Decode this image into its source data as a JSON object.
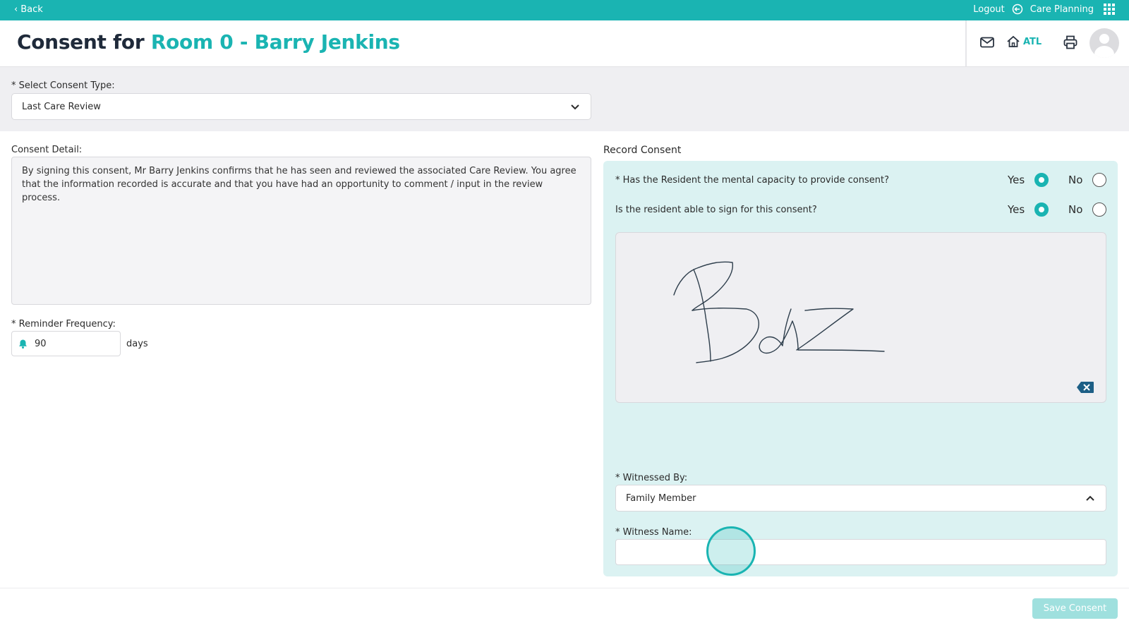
{
  "topbar": {
    "back_label": "Back",
    "logout_label": "Logout",
    "module_label": "Care Planning"
  },
  "header": {
    "title_prefix": "Consent for",
    "title_subject": "Room 0 - Barry Jenkins",
    "home_code": "ATL"
  },
  "consent_type": {
    "label": "* Select Consent Type:",
    "value": "Last Care Review"
  },
  "consent_detail": {
    "label": "Consent Detail:",
    "text": "By signing this consent, Mr Barry Jenkins confirms that he has seen and reviewed the associated Care Review.  You agree that the information recorded is accurate and that you have had an opportunity to comment / input in the review process."
  },
  "reminder": {
    "label": "* Reminder Frequency:",
    "value": "90",
    "unit": "days"
  },
  "record_consent": {
    "title": "Record Consent",
    "questions": [
      {
        "text": "* Has the Resident the mental capacity to provide consent?",
        "yes_label": "Yes",
        "no_label": "No",
        "selected": "Yes"
      },
      {
        "text": "Is the resident able to sign for this consent?",
        "yes_label": "Yes",
        "no_label": "No",
        "selected": "Yes"
      }
    ],
    "signature_text": "Baz",
    "witnessed_by": {
      "label": "* Witnessed By:",
      "value": "Family Member"
    },
    "witness_name": {
      "label": "* Witness Name:",
      "value": ""
    }
  },
  "footer": {
    "save_label": "Save Consent"
  },
  "colors": {
    "accent": "#1ab4b2",
    "panel_bg": "#dbf2f2",
    "band_bg": "#efeff2",
    "disabled_button": "#9fe0de"
  }
}
